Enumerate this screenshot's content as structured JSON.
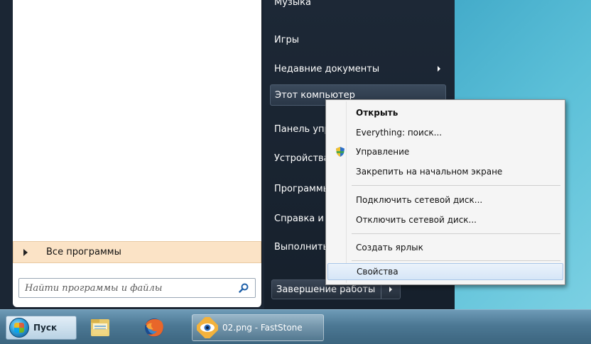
{
  "start_menu": {
    "all_programs_label": "Все программы",
    "search_placeholder": "Найти программы и файлы",
    "right_items": [
      {
        "label": "Музыка"
      },
      {
        "label": "Игры"
      },
      {
        "label": "Недавние документы"
      },
      {
        "label": "Этот компьютер"
      },
      {
        "label": "Панель управления"
      },
      {
        "label": "Устройства и принтеры"
      },
      {
        "label": "Программы по умолчанию"
      },
      {
        "label": "Справка и поддержка"
      },
      {
        "label": "Выполнить..."
      }
    ],
    "shutdown_label": "Завершение работы"
  },
  "context_menu": {
    "items": [
      {
        "label": "Открыть"
      },
      {
        "label": "Everything: поиск..."
      },
      {
        "label": "Управление"
      },
      {
        "label": "Закрепить на начальном экране"
      },
      {
        "label": "Подключить сетевой диск..."
      },
      {
        "label": "Отключить сетевой диск..."
      },
      {
        "label": "Создать ярлык"
      },
      {
        "label": "Свойства"
      }
    ]
  },
  "taskbar": {
    "start_label": "Пуск",
    "active_window_title": "02.png - FastStone"
  },
  "colors": {
    "menu_dark": "#1b2634",
    "all_programs_bg": "#fbe3c6",
    "context_selected": "#d6e6f7",
    "taskbar": "#4c7894"
  }
}
